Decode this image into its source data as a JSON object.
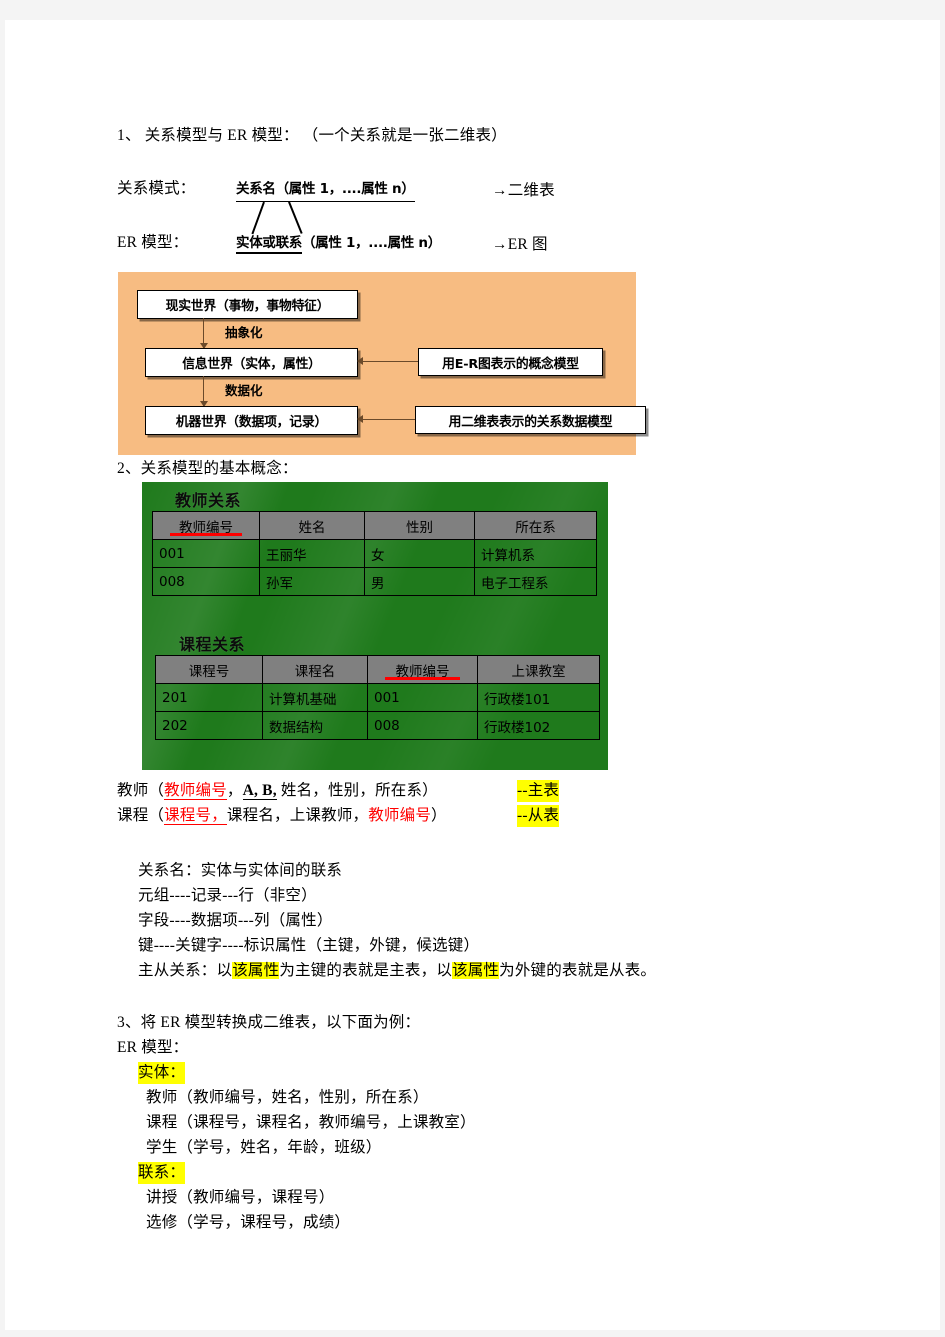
{
  "section1": {
    "title": "1、 关系模型与 ER 模型： （一个关系就是一张二维表）",
    "schema_label": "关系模式：",
    "schema_formula": "关系名（属性 1，....属性 n）",
    "schema_arrow": "→二维表",
    "er_label": "ER 模型：",
    "er_formula_underlined": "实体或联系",
    "er_formula_rest": "（属性 1，....属性 n）",
    "er_arrow": "→ER 图"
  },
  "diagram": {
    "background_color": "#f7bc82",
    "box_real_world": "现实世界（事物，事物特征）",
    "box_info_world": "信息世界（实体，属性）",
    "box_machine_world": "机器世界（数据项，记录）",
    "label_abstraction": "抽象化",
    "label_datafication": "数据化",
    "box_er_note": "用E-R图表示的概念模型",
    "box_rel_note": "用二维表表示的关系数据模型"
  },
  "section2": {
    "title": "2、关系模型的基本概念：",
    "green_color": "#1f7a1c",
    "header_color": "#808080",
    "teacher_table": {
      "caption": "教师关系",
      "columns": [
        "教师编号",
        "姓名",
        "性别",
        "所在系"
      ],
      "key_column_index": 0,
      "rows": [
        [
          "001",
          "王丽华",
          "女",
          "计算机系"
        ],
        [
          "008",
          "孙军",
          "男",
          "电子工程系"
        ]
      ]
    },
    "course_table": {
      "caption": "课程关系",
      "columns": [
        "课程号",
        "课程名",
        "教师编号",
        "上课教室"
      ],
      "key_column_index": 2,
      "rows": [
        [
          "201",
          "计算机基础",
          "001",
          "行政楼101"
        ],
        [
          "202",
          "数据结构",
          "008",
          "行政楼102"
        ]
      ]
    }
  },
  "relations": {
    "teacher_prefix": "教师（",
    "teacher_key": "教师编号",
    "teacher_sep1": "，",
    "teacher_ab": "A, B,",
    "teacher_rest": " 姓名，性别，所在系）",
    "teacher_tag": "--主表",
    "course_prefix": "课程（",
    "course_key": "课程号，",
    "course_mid": "课程名，上课教师，",
    "course_fk": "教师编号",
    "course_suffix": "）",
    "course_tag": "--从表"
  },
  "definitions": {
    "line1": "关系名：实体与实体间的联系",
    "line2": "元组----记录---行（非空）",
    "line3": "字段----数据项---列（属性）",
    "line4": "键----关键字----标识属性（主键，外键，候选键）",
    "line5_a": "主从关系：以",
    "line5_hl1": "该属性",
    "line5_b": "为主键的表就是主表，以",
    "line5_hl2": "该属性",
    "line5_c": "为外键的表就是从表。"
  },
  "section3": {
    "title": "3、将 ER 模型转换成二维表，以下面为例：",
    "er_label": "ER 模型：",
    "entity_heading": "实体：",
    "entity_1": "教师（教师编号，姓名，性别，所在系）",
    "entity_2": "课程（课程号，课程名，教师编号，上课教室）",
    "entity_3": "学生（学号，姓名，年龄，班级）",
    "relation_heading": "联系：",
    "relation_1": "讲授（教师编号，课程号）",
    "relation_2": "选修（学号，课程号，成绩）"
  },
  "highlight_color": "#ffff00"
}
